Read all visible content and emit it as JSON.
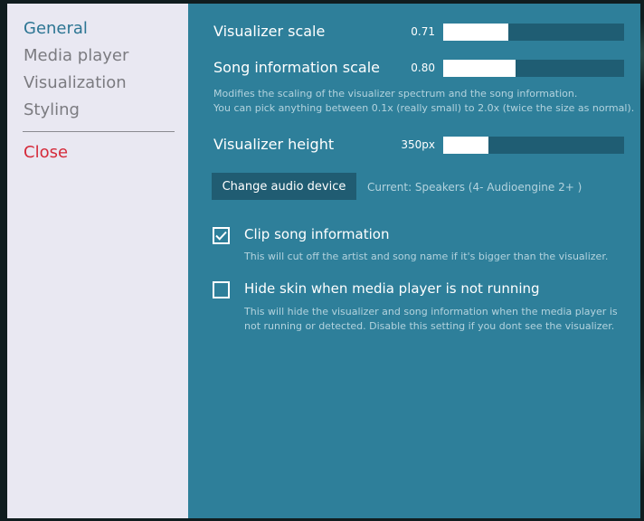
{
  "sidebar": {
    "items": [
      {
        "label": "General"
      },
      {
        "label": "Media player"
      },
      {
        "label": "Visualization"
      },
      {
        "label": "Styling"
      }
    ],
    "close_label": "Close"
  },
  "general": {
    "visualizer_scale": {
      "label": "Visualizer scale",
      "value": "0.71",
      "fill_fraction": 0.36
    },
    "song_info_scale": {
      "label": "Song information scale",
      "value": "0.80",
      "fill_fraction": 0.4
    },
    "scale_description": {
      "line1": "Modifies the scaling of the visualizer spectrum and the song information.",
      "line2": "You can pick anything between 0.1x (really small) to 2.0x (twice the size as normal)."
    },
    "visualizer_height": {
      "label": "Visualizer height",
      "value": "350px",
      "fill_fraction": 0.25
    },
    "audio_device": {
      "button_label": "Change audio device",
      "current": "Current: Speakers (4- Audioengine 2+ )"
    },
    "clip_song_info": {
      "label": "Clip song information",
      "checked": true,
      "description": "This will cut off the artist and song name if it's bigger than the visualizer."
    },
    "hide_skin": {
      "label": "Hide skin when media player is not running",
      "checked": false,
      "description_line1": "This will hide the visualizer and song information when the media player is",
      "description_line2": "not running or detected. Disable this setting if you dont see the visualizer."
    }
  },
  "colors": {
    "sidebar_bg": "#e9e8f2",
    "content_bg": "#2e7f9a",
    "active_nav": "#2c7593",
    "close": "#d52a3a",
    "slider_track": "#1f5d73",
    "button_bg": "#205c72"
  }
}
